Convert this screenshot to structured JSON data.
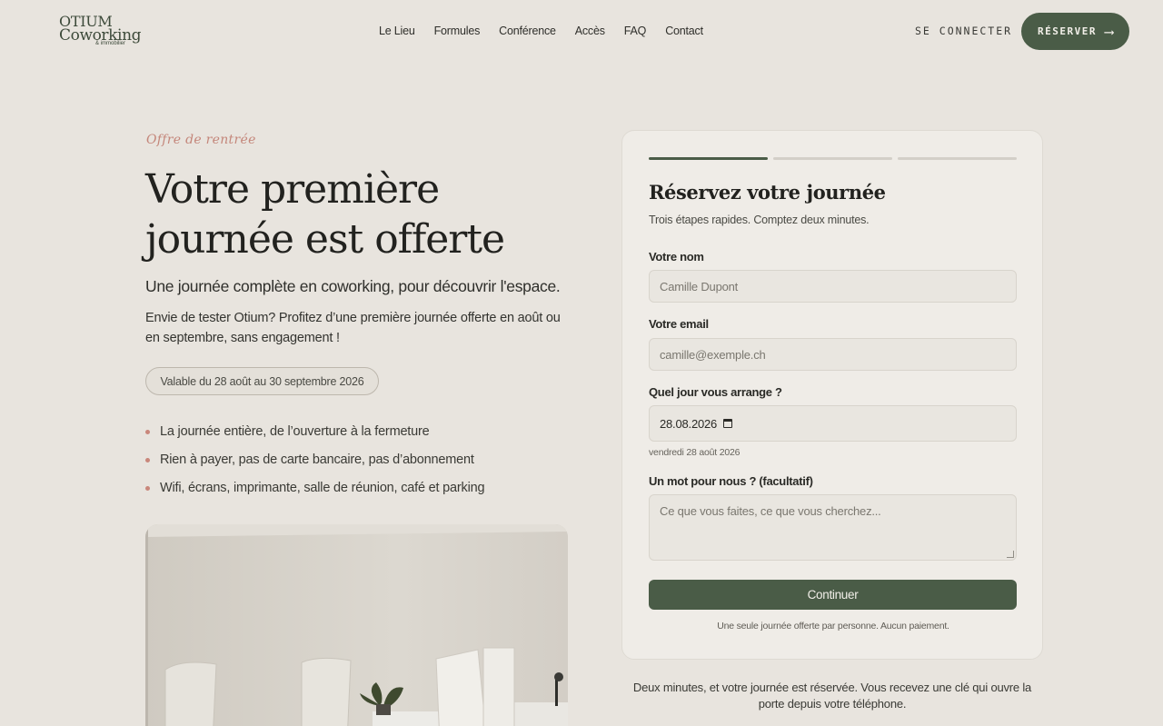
{
  "header": {
    "logo": {
      "line1": "OTIUM",
      "line2": "Coworking",
      "line3": "& immobilier"
    },
    "nav": [
      "Le Lieu",
      "Formules",
      "Conférence",
      "Accès",
      "FAQ",
      "Contact"
    ],
    "login_label": "SE CONNECTER",
    "reserve_label": "RÉSERVER",
    "reserve_arrow": "⟶",
    "brand_color": "#4a5c47"
  },
  "hero": {
    "eyebrow": "Offre de rentrée",
    "title": "Votre première journée est offerte",
    "lead": "Une journée complète en coworking, pour découvrir l'espace.",
    "description": "Envie de tester Otium? Profitez d’une première journée offerte en août ou en septembre, sans engagement !",
    "badge": "Valable du 28 août au 30 septembre 2026",
    "features": [
      "La journée entière, de l’ouverture à la fermeture",
      "Rien à payer, pas de carte bancaire, pas d’abonnement",
      "Wifi, écrans, imprimante, salle de réunion, café et parking"
    ],
    "accent_color": "#c9877b"
  },
  "form": {
    "steps_total": 3,
    "current_step": 1,
    "title": "Réservez votre journée",
    "subtitle": "Trois étapes rapides. Comptez deux minutes.",
    "name_label": "Votre nom",
    "name_placeholder": "Camille Dupont",
    "email_label": "Votre email",
    "email_placeholder": "camille@exemple.ch",
    "date_label": "Quel jour vous arrange ?",
    "date_value": "28.08.2026",
    "date_hint": "vendredi 28 août 2026",
    "message_label": "Un mot pour nous ? (facultatif)",
    "message_placeholder": "Ce que vous faites, ce que vous cherchez...",
    "continue_label": "Continuer",
    "fine_print": "Une seule journée offerte par personne. Aucun paiement."
  },
  "below_card": "Deux minutes, et votre journée est réservée. Vous recevez une clé qui ouvre la porte depuis votre téléphone."
}
